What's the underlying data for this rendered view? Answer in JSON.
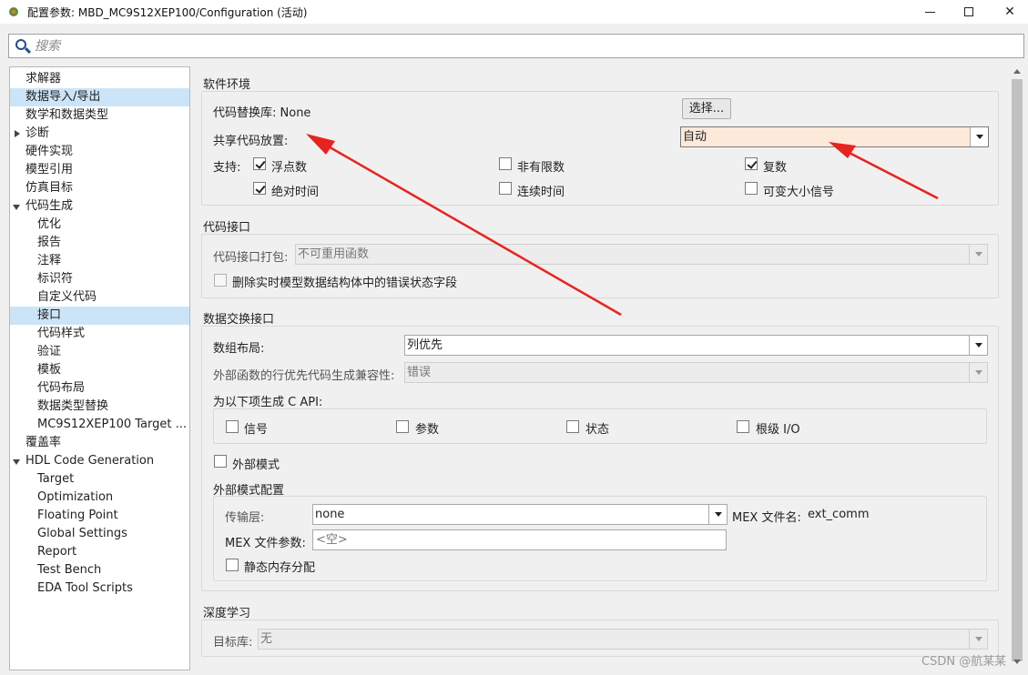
{
  "window": {
    "title": "配置参数: MBD_MC9S12XEP100/Configuration (活动)",
    "controls": [
      "minimize-icon",
      "maximize-icon",
      "close-icon"
    ]
  },
  "search": {
    "placeholder": "搜索"
  },
  "tree": {
    "items": [
      {
        "label": "求解器",
        "level": 1,
        "selected": false
      },
      {
        "label": "数据导入/导出",
        "level": 1,
        "selected": false,
        "hover": true
      },
      {
        "label": "数学和数据类型",
        "level": 1,
        "selected": false
      },
      {
        "label": "诊断",
        "level": 1,
        "expander": "collapsed"
      },
      {
        "label": "硬件实现",
        "level": 1
      },
      {
        "label": "模型引用",
        "level": 1
      },
      {
        "label": "仿真目标",
        "level": 1
      },
      {
        "label": "代码生成",
        "level": 1,
        "expander": "expanded"
      },
      {
        "label": "优化",
        "level": 2
      },
      {
        "label": "报告",
        "level": 2
      },
      {
        "label": "注释",
        "level": 2
      },
      {
        "label": "标识符",
        "level": 2
      },
      {
        "label": "自定义代码",
        "level": 2
      },
      {
        "label": "接口",
        "level": 2,
        "selected": true
      },
      {
        "label": "代码样式",
        "level": 2
      },
      {
        "label": "验证",
        "level": 2
      },
      {
        "label": "模板",
        "level": 2
      },
      {
        "label": "代码布局",
        "level": 2
      },
      {
        "label": "数据类型替换",
        "level": 2
      },
      {
        "label": "MC9S12XEP100 Target ...",
        "level": 2
      },
      {
        "label": "覆盖率",
        "level": 1
      },
      {
        "label": "HDL Code Generation",
        "level": 1,
        "expander": "expanded"
      },
      {
        "label": "Target",
        "level": 2
      },
      {
        "label": "Optimization",
        "level": 2
      },
      {
        "label": "Floating Point",
        "level": 2
      },
      {
        "label": "Global Settings",
        "level": 2
      },
      {
        "label": "Report",
        "level": 2
      },
      {
        "label": "Test Bench",
        "level": 2
      },
      {
        "label": "EDA Tool Scripts",
        "level": 2
      }
    ]
  },
  "software_env": {
    "title": "软件环境",
    "code_replacement_label": "代码替换库: None",
    "select_button": "选择...",
    "shared_code_label": "共享代码放置:",
    "shared_code_value": "自动",
    "support_label": "支持:",
    "checks": [
      {
        "label": "浮点数",
        "checked": true
      },
      {
        "label": "非有限数",
        "checked": false
      },
      {
        "label": "复数",
        "checked": true
      },
      {
        "label": "绝对时间",
        "checked": true
      },
      {
        "label": "连续时间",
        "checked": false
      },
      {
        "label": "可变大小信号",
        "checked": false
      }
    ]
  },
  "code_interface": {
    "title": "代码接口",
    "packaging_label": "代码接口打包:",
    "packaging_value": "不可重用函数",
    "remove_error_label": "删除实时模型数据结构体中的错误状态字段"
  },
  "data_exchange": {
    "title": "数据交换接口",
    "array_layout_label": "数组布局:",
    "array_layout_value": "列优先",
    "ext_fn_label": "外部函数的行优先代码生成兼容性:",
    "ext_fn_value": "错误",
    "capi_label": "为以下项生成 C API:",
    "capi_items": [
      "信号",
      "参数",
      "状态",
      "根级 I/O"
    ],
    "external_mode_label": "外部模式",
    "ext_mode_config_title": "外部模式配置",
    "transport_label": "传输层:",
    "transport_value": "none",
    "mex_file_label": "MEX 文件名:",
    "mex_file_value": "ext_comm",
    "mex_args_label": "MEX 文件参数:",
    "mex_args_placeholder": "<空>",
    "static_mem_label": "静态内存分配"
  },
  "deep_learning": {
    "title": "深度学习",
    "target_lib_label": "目标库:",
    "target_lib_value": "无"
  },
  "watermark": "CSDN @航某某",
  "colors": {
    "selection": "#cce4f7",
    "highlight_field": "#fde9d9",
    "annotation_arrow": "#e8231f"
  }
}
